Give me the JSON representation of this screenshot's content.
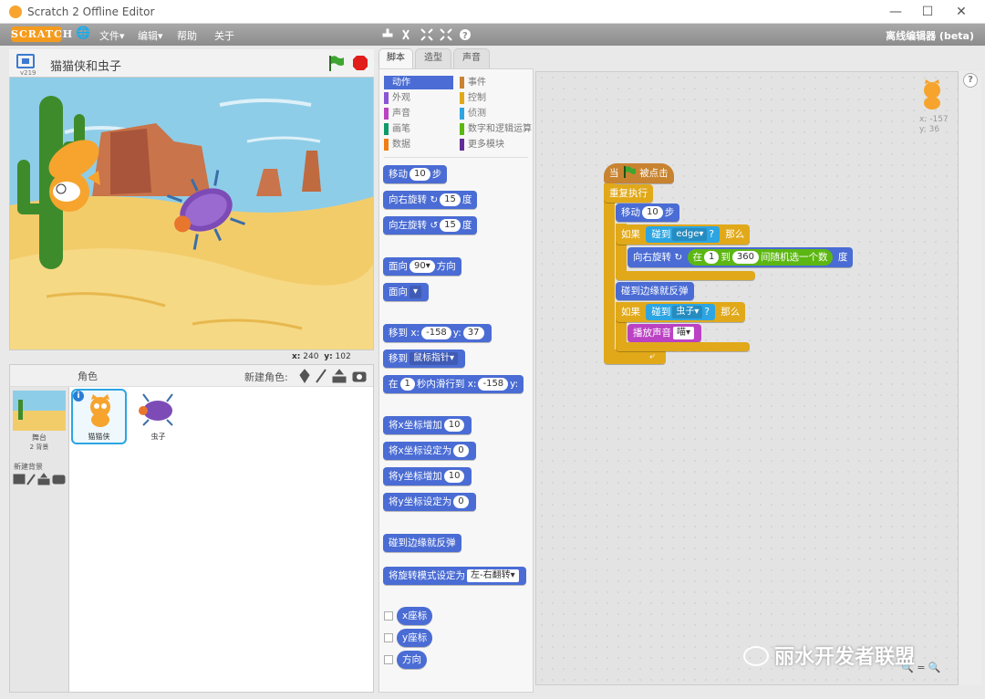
{
  "window": {
    "title": "Scratch 2 Offline Editor",
    "minimize": "—",
    "maximize": "☐",
    "close": "✕"
  },
  "menubar": {
    "logo": "SCRATCH",
    "globe": "🌐",
    "file": "文件▾",
    "edit": "编辑▾",
    "help": "帮助",
    "about": "关于",
    "mode": "离线编辑器 (beta)"
  },
  "stage_header": {
    "project_title": "猫猫侠和虫子",
    "version": "v219"
  },
  "stage_coords": {
    "x_label": "x:",
    "x_value": "240",
    "y_label": "y:",
    "y_value": "102"
  },
  "sprites_pane": {
    "header": "角色",
    "new_sprite": "新建角色:",
    "stage_label": "舞台",
    "stage_backdrops": "2 背景",
    "new_backdrop": "新建背景",
    "sprites": [
      {
        "name": "猫猫侠",
        "selected": true
      },
      {
        "name": "虫子",
        "selected": false
      }
    ]
  },
  "tabs": [
    {
      "label": "脚本",
      "active": true
    },
    {
      "label": "造型",
      "active": false
    },
    {
      "label": "声音",
      "active": false
    }
  ],
  "categories": [
    {
      "label": "动作",
      "color": "#4a6cd4",
      "selected": true
    },
    {
      "label": "事件",
      "color": "#c88330"
    },
    {
      "label": "外观",
      "color": "#8a55d7"
    },
    {
      "label": "控制",
      "color": "#e1a91a"
    },
    {
      "label": "声音",
      "color": "#bb42c3"
    },
    {
      "label": "侦测",
      "color": "#2ca5e2"
    },
    {
      "label": "画笔",
      "color": "#0e9a6c"
    },
    {
      "label": "数字和逻辑运算",
      "color": "#5cb712"
    },
    {
      "label": "数据",
      "color": "#ee7d16"
    },
    {
      "label": "更多模块",
      "color": "#632d99"
    }
  ],
  "palette_blocks": {
    "move": {
      "pre": "移动",
      "num": "10",
      "post": "步"
    },
    "turn_right": {
      "pre": "向右旋转",
      "icon": "↻",
      "num": "15",
      "post": "度"
    },
    "turn_left": {
      "pre": "向左旋转",
      "icon": "↺",
      "num": "15",
      "post": "度"
    },
    "point_dir": {
      "pre": "面向",
      "num": "90▾",
      "post": "方向"
    },
    "point_towards": {
      "pre": "面向",
      "drop": "▾"
    },
    "goto_xy": {
      "pre": "移到 x:",
      "x": "-158",
      "mid": "y:",
      "y": "37"
    },
    "goto": {
      "pre": "移到",
      "drop": "鼠标指针▾"
    },
    "glide": {
      "pre": "在",
      "num": "1",
      "mid": "秒内滑行到 x:",
      "x": "-158",
      "post": "y:"
    },
    "change_x": {
      "pre": "将x坐标增加",
      "num": "10"
    },
    "set_x": {
      "pre": "将x坐标设定为",
      "num": "0"
    },
    "change_y": {
      "pre": "将y坐标增加",
      "num": "10"
    },
    "set_y": {
      "pre": "将y坐标设定为",
      "num": "0"
    },
    "bounce": {
      "label": "碰到边缘就反弹"
    },
    "rotation_style": {
      "pre": "将旋转模式设定为",
      "drop": "左-右翻转▾"
    },
    "xpos": "x座标",
    "ypos": "y座标",
    "direction": "方向"
  },
  "script": {
    "hat": {
      "pre": "当",
      "post": "被点击"
    },
    "forever": "重复执行",
    "move": {
      "pre": "移动",
      "num": "10",
      "post": "步"
    },
    "if1": {
      "pre": "如果",
      "touch": "碰到",
      "target": "edge▾",
      "q": "?",
      "then": "那么"
    },
    "turn": {
      "pre": "向右旋转",
      "icon": "↻",
      "rand_pre": "在",
      "from": "1",
      "to_label": "到",
      "to": "360",
      "rand_post": "间随机选一个数",
      "post": "度"
    },
    "bounce": "碰到边缘就反弹",
    "if2": {
      "pre": "如果",
      "touch": "碰到",
      "target": "虫子▾",
      "q": "?",
      "then": "那么"
    },
    "play": {
      "pre": "播放声音",
      "drop": "喵▾"
    }
  },
  "sprite_info": {
    "x_label": "x:",
    "x_value": "-157",
    "y_label": "y:",
    "y_value": "36"
  },
  "zoom": {
    "out": "🔍",
    "reset": "=",
    "in": "🔍"
  },
  "help_icon": "?",
  "watermark": "丽水开发者联盟"
}
